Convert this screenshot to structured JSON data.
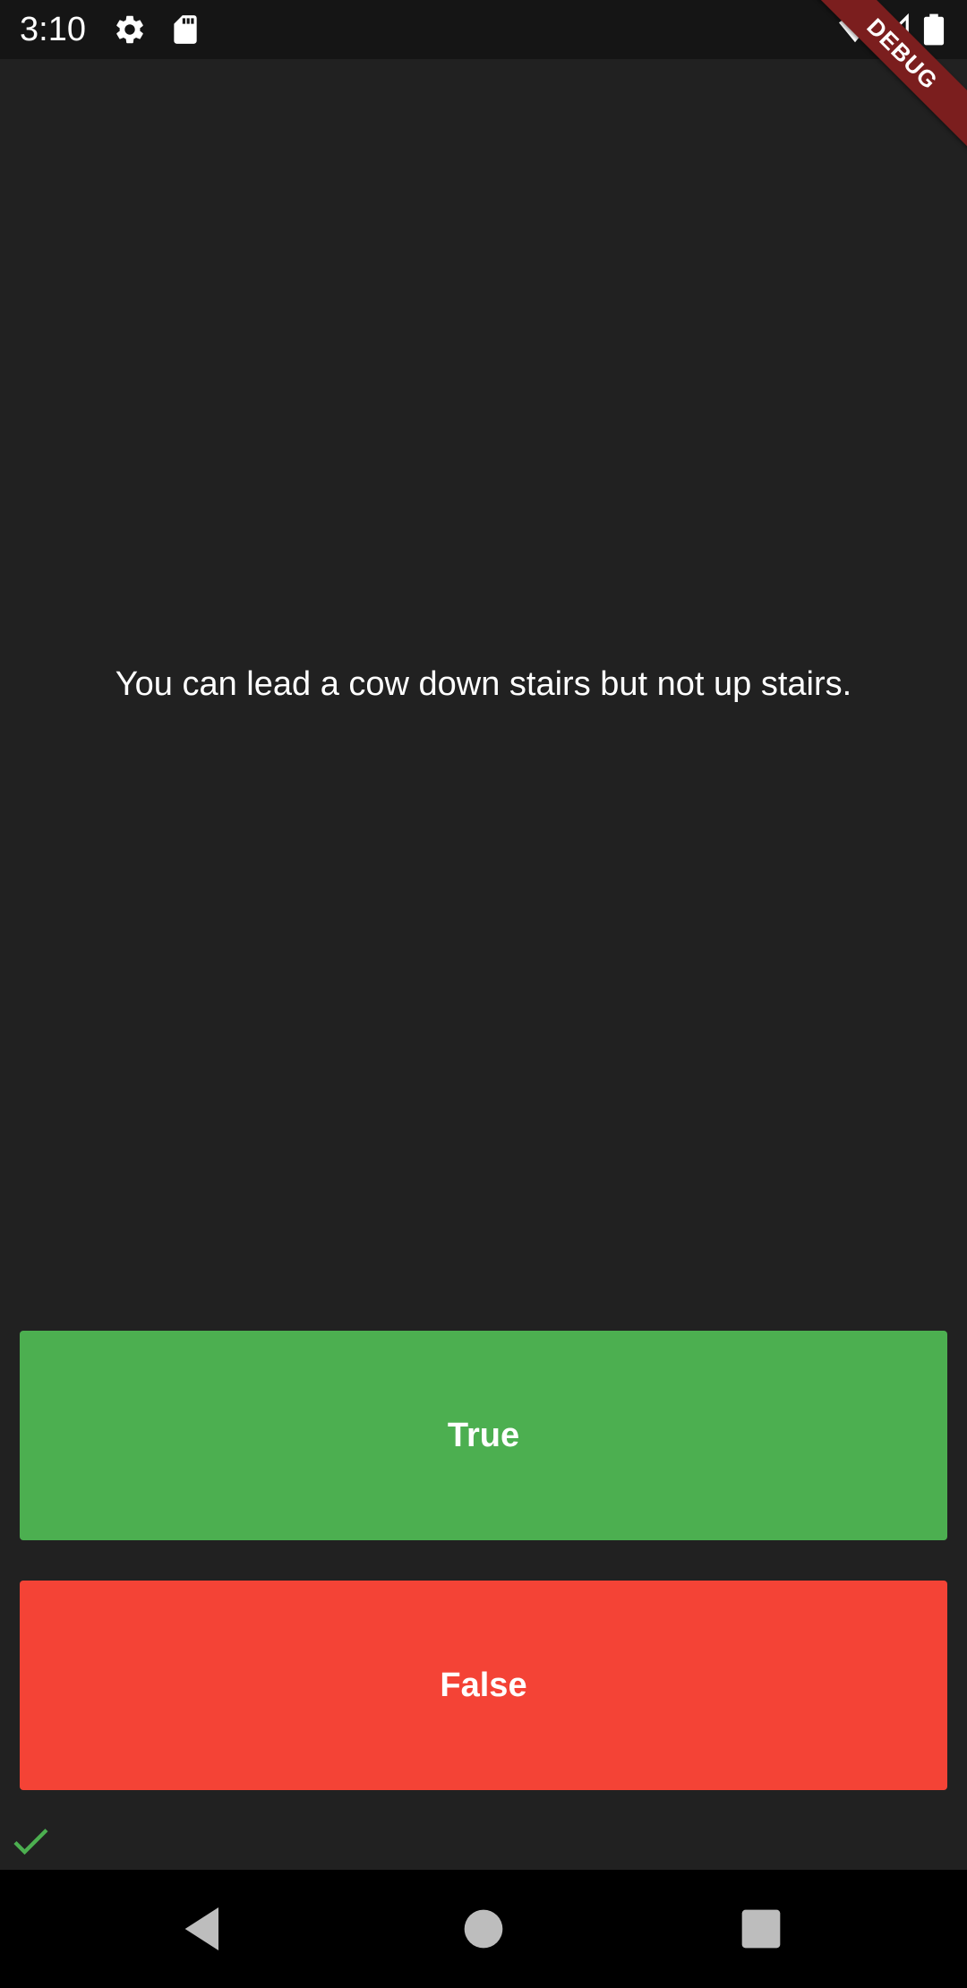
{
  "status_bar": {
    "time": "3:10",
    "left_icons": [
      "gear-icon",
      "sd-card-icon"
    ],
    "right_icons": [
      "wifi-icon",
      "signal-icon",
      "battery-icon"
    ]
  },
  "debug_banner": "DEBUG",
  "quiz": {
    "question": "You can lead a cow down stairs but not up stairs.",
    "true_label": "True",
    "false_label": "False",
    "score_keeper": [
      "check-icon"
    ]
  },
  "colors": {
    "background": "#212121",
    "true_button": "#4caf50",
    "false_button": "#f44336",
    "correct_icon": "#4caf50",
    "debug_ribbon": "#7b1e1e"
  },
  "nav_bar": {
    "buttons": [
      "back-icon",
      "home-icon",
      "recents-icon"
    ]
  }
}
